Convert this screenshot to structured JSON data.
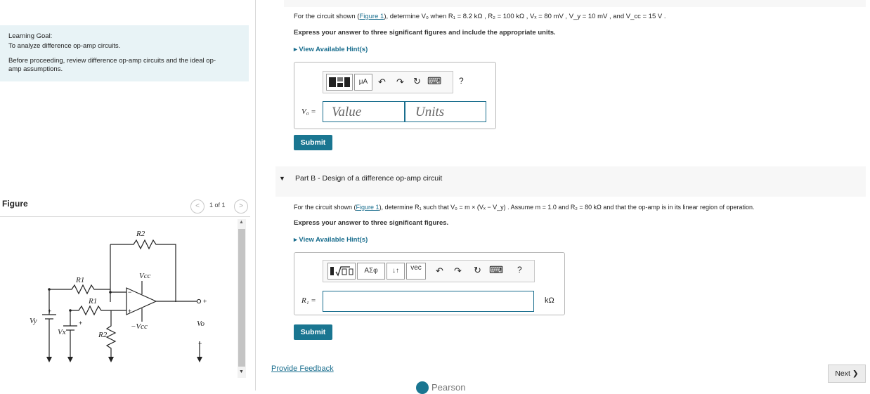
{
  "learning_goal": {
    "heading": "Learning Goal:",
    "text": "To analyze difference op-amp circuits.",
    "review_line1": "Before proceeding, review difference op-amp circuits and the ideal op-",
    "review_line2": "amp assumptions."
  },
  "figure": {
    "label": "Figure",
    "pager": "1 of 1",
    "prev_glyph": "<",
    "next_glyph": ">",
    "labels": {
      "r2": "R2",
      "r1a": "R1",
      "r1b": "R1",
      "r2b": "R2",
      "vcc": "Vcc",
      "neg_vcc": "−Vcc",
      "vy": "Vy",
      "vx": "Vx",
      "vo": "Vo",
      "plus": "+",
      "minus": "−"
    }
  },
  "part_a": {
    "q_prefix": "For the circuit shown (",
    "q_link": "Figure 1",
    "q_suffix": "), determine V₀ when R₁ = 8.2 kΩ , R₂ = 100 kΩ , Vₓ = 80 mV , V_y = 10 mV , and V_cc = 15 V .",
    "instruction": "Express your answer to three significant figures and include the appropriate units.",
    "hint": "▸  View Available Hint(s)",
    "answer_label": "V₀ =",
    "value_placeholder": "Value",
    "units_placeholder": "Units",
    "toolbar": {
      "units_btn": "μA",
      "help": "?"
    },
    "submit": "Submit"
  },
  "part_b": {
    "caret": "▼",
    "title": "Part B - Design of a difference op-amp circuit",
    "q_prefix": "For the circuit shown (",
    "q_link": "Figure 1",
    "q_suffix": "), determine R₁ such that V₀ = m × (Vₓ − V_y) . Assume m = 1.0 and R₂ = 80 kΩ  and that the op-amp is in its linear region of operation.",
    "instruction": "Express your answer to three significant figures.",
    "hint": "▸  View Available Hint(s)",
    "answer_label": "R₁ =",
    "unit": "kΩ",
    "toolbar": {
      "greek_btn": "ΑΣφ",
      "sort_btn": "↓↑",
      "vec_btn": "vec",
      "help": "?"
    },
    "submit": "Submit"
  },
  "footer": {
    "feedback": "Provide Feedback",
    "next": "Next ❯",
    "brand": "Pearson"
  }
}
